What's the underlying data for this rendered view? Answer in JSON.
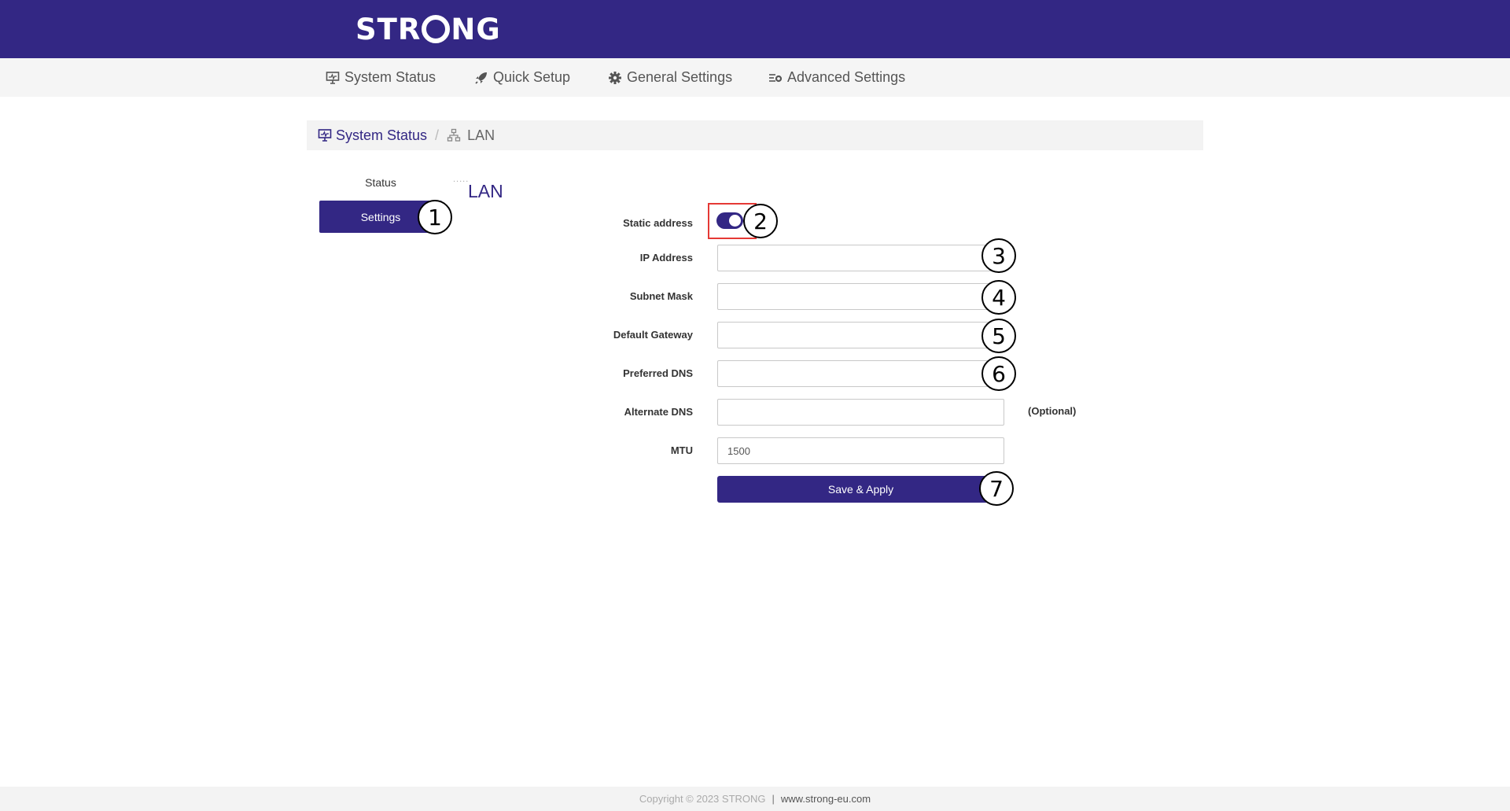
{
  "brand": {
    "logo_text_before": "STR",
    "logo_text_after": "NG",
    "logo_full": "STRONG"
  },
  "nav": {
    "items": [
      {
        "label": "System Status",
        "icon": "monitor-icon"
      },
      {
        "label": "Quick Setup",
        "icon": "rocket-icon"
      },
      {
        "label": "General Settings",
        "icon": "gear-icon"
      },
      {
        "label": "Advanced Settings",
        "icon": "sliders-gear-icon"
      }
    ]
  },
  "breadcrumb": {
    "parent": "System Status",
    "separator": "/",
    "current": "LAN"
  },
  "sidebar": {
    "items": [
      {
        "label": "Status",
        "active": false
      },
      {
        "label": "Settings",
        "active": true
      }
    ]
  },
  "section": {
    "title": "LAN",
    "dots": "....."
  },
  "form": {
    "static_address": {
      "label": "Static address",
      "enabled": true
    },
    "ip_address": {
      "label": "IP Address",
      "value": ""
    },
    "subnet_mask": {
      "label": "Subnet Mask",
      "value": ""
    },
    "default_gateway": {
      "label": "Default Gateway",
      "value": ""
    },
    "preferred_dns": {
      "label": "Preferred DNS",
      "value": ""
    },
    "alternate_dns": {
      "label": "Alternate DNS",
      "value": "",
      "note": "(Optional)"
    },
    "mtu": {
      "label": "MTU",
      "value": "1500"
    },
    "save_label": "Save & Apply"
  },
  "callouts": [
    "1",
    "2",
    "3",
    "4",
    "5",
    "6",
    "7"
  ],
  "footer": {
    "copyright": "Copyright © 2023 STRONG",
    "separator": "|",
    "link": "www.strong-eu.com"
  },
  "colors": {
    "brand": "#332784",
    "highlight": "#e53935",
    "navbar_bg": "#f5f5f5"
  }
}
